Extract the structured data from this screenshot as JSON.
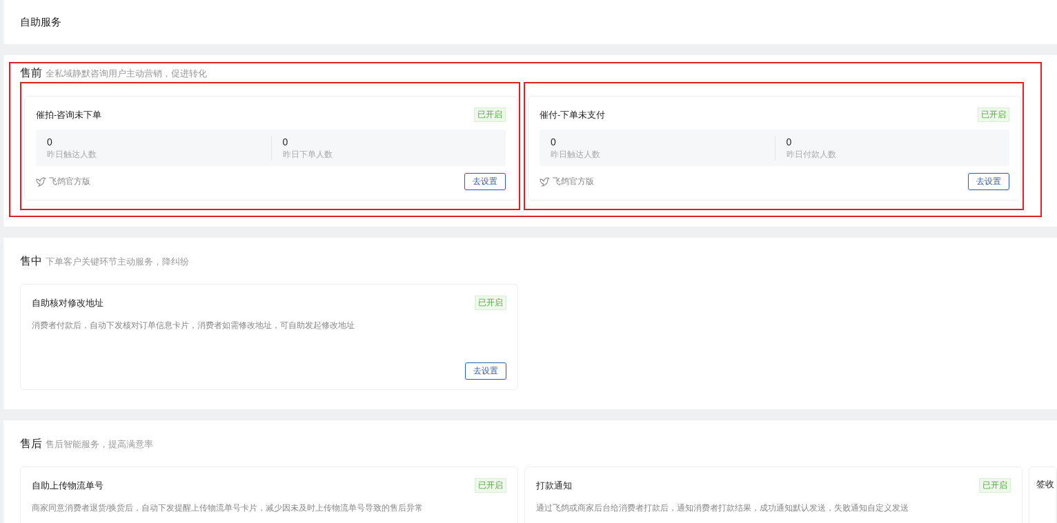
{
  "page_title": "自助服务",
  "sections": [
    {
      "title": "售前",
      "subtitle": "全私域静默咨询用户主动营销，促进转化",
      "highlighted": true,
      "cards": [
        {
          "kind": "stats",
          "title": "催拍-咨询未下单",
          "status": "已开启",
          "on": true,
          "highlighted": true,
          "stats": [
            {
              "value": "0",
              "label": "昨日触达人数"
            },
            {
              "value": "0",
              "label": "昨日下单人数"
            }
          ],
          "source": "飞鸽官方版",
          "button": "去设置"
        },
        {
          "kind": "stats",
          "title": "催付-下单未支付",
          "status": "已开启",
          "on": true,
          "highlighted": true,
          "stats": [
            {
              "value": "0",
              "label": "昨日触达人数"
            },
            {
              "value": "0",
              "label": "昨日付款人数"
            }
          ],
          "source": "飞鸽官方版",
          "button": "去设置"
        }
      ]
    },
    {
      "title": "售中",
      "subtitle": "下单客户关键环节主动服务，降纠纷",
      "highlighted": false,
      "cards": [
        {
          "kind": "description",
          "title": "自助核对修改地址",
          "status": "已开启",
          "on": true,
          "highlighted": false,
          "description": "消费者付款后，自动下发核对订单信息卡片，消费者如需修改地址，可自助发起修改地址",
          "button": "去设置"
        }
      ]
    },
    {
      "title": "售后",
      "subtitle": "售后智能服务，提高满意率",
      "highlighted": false,
      "cards": [
        {
          "kind": "description",
          "title": "自助上传物流单号",
          "status": "已开启",
          "on": true,
          "highlighted": false,
          "description": "商家同意消费者退货/换货后，自动下发提醒上传物流单号卡片，减少因未及时上传物流单号导致的售后异常"
        },
        {
          "kind": "description",
          "title": "打款通知",
          "status": "已开启",
          "on": true,
          "highlighted": false,
          "description": "通过飞鸽或商家后台给消费者打款后，通知消费者打款结果，成功通知默认发送，失败通知自定义发送"
        },
        {
          "kind": "partial",
          "title": "签收"
        }
      ]
    }
  ]
}
